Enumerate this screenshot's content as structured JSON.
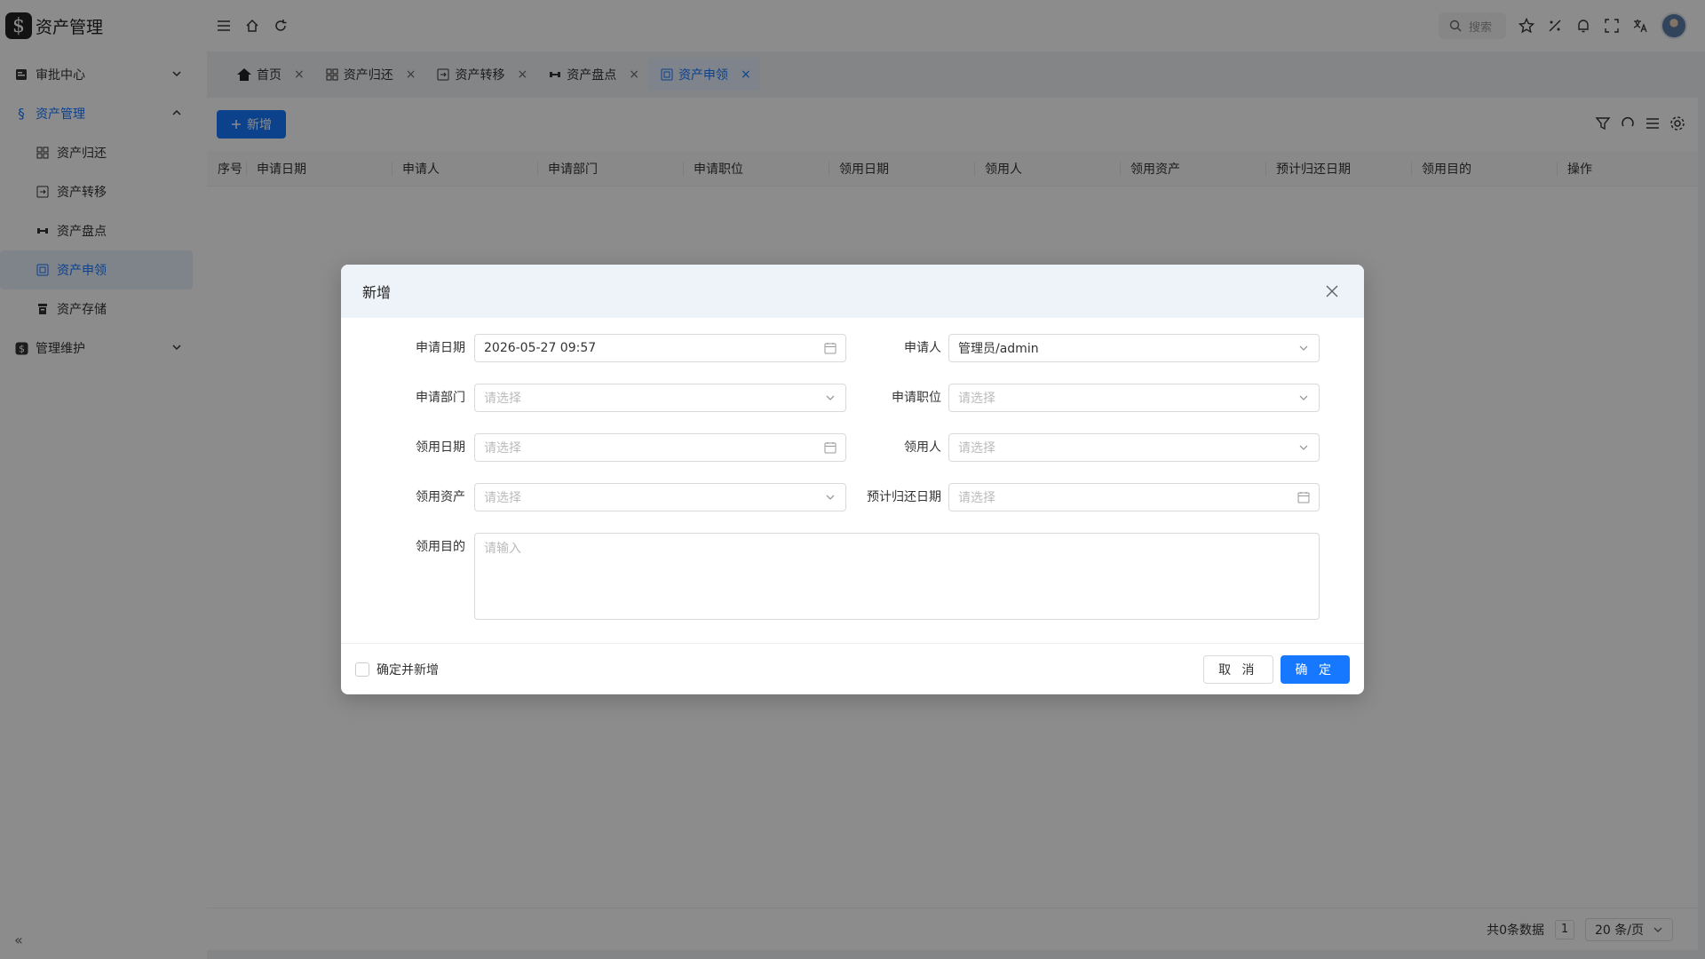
{
  "app": {
    "logo_glyph": "$",
    "title": "资产管理"
  },
  "sidebar": {
    "items": [
      {
        "label": "审批中心",
        "icon": "approval-icon",
        "expanded": false
      },
      {
        "label": "资产管理",
        "icon": "asset-icon",
        "expanded": true,
        "children": [
          {
            "label": "资产归还",
            "icon": "return-icon"
          },
          {
            "label": "资产转移",
            "icon": "transfer-icon"
          },
          {
            "label": "资产盘点",
            "icon": "inventory-icon"
          },
          {
            "label": "资产申领",
            "icon": "apply-icon",
            "selected": true
          },
          {
            "label": "资产存储",
            "icon": "storage-icon"
          }
        ]
      },
      {
        "label": "管理维护",
        "icon": "maintain-icon",
        "expanded": false
      }
    ],
    "collapse_glyph": "«"
  },
  "header": {
    "search_placeholder": "搜索"
  },
  "tabs": [
    {
      "label": "首页",
      "icon": "home-icon"
    },
    {
      "label": "资产归还",
      "icon": "return-icon"
    },
    {
      "label": "资产转移",
      "icon": "transfer-icon"
    },
    {
      "label": "资产盘点",
      "icon": "inventory-icon"
    },
    {
      "label": "资产申领",
      "icon": "apply-icon",
      "active": true
    }
  ],
  "toolbar": {
    "add_label": "新增"
  },
  "table": {
    "columns": [
      "序号",
      "申请日期",
      "申请人",
      "申请部门",
      "申请职位",
      "领用日期",
      "领用人",
      "领用资产",
      "预计归还日期",
      "领用目的",
      "操作"
    ]
  },
  "pagination": {
    "total_text": "共0条数据",
    "current_page": "1",
    "page_size": "20 条/页"
  },
  "modal": {
    "title": "新增",
    "fields": {
      "apply_date": {
        "label": "申请日期",
        "value": "2026-05-27 09:57"
      },
      "applicant": {
        "label": "申请人",
        "value": "管理员/admin"
      },
      "department": {
        "label": "申请部门",
        "placeholder": "请选择"
      },
      "position": {
        "label": "申请职位",
        "placeholder": "请选择"
      },
      "receive_date": {
        "label": "领用日期",
        "placeholder": "请选择"
      },
      "receiver": {
        "label": "领用人",
        "placeholder": "请选择"
      },
      "asset": {
        "label": "领用资产",
        "placeholder": "请选择"
      },
      "return_date": {
        "label": "预计归还日期",
        "placeholder": "请选择"
      },
      "purpose": {
        "label": "领用目的",
        "placeholder": "请输入"
      }
    },
    "confirm_and_add_label": "确定并新增",
    "cancel_label": "取 消",
    "ok_label": "确 定"
  },
  "colors": {
    "primary": "#1677ff",
    "overlay": "rgba(0,0,0,0.45)"
  }
}
